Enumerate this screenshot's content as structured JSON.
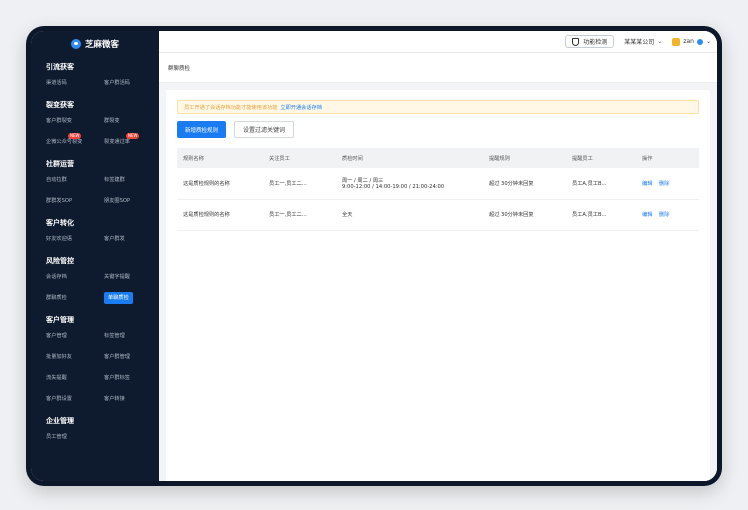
{
  "app": {
    "name": "芝麻微客"
  },
  "sidebar": {
    "groups": [
      {
        "title": "引流获客",
        "items": [
          {
            "label": "渠道活码"
          },
          {
            "label": "客户群活码"
          }
        ]
      },
      {
        "title": "裂变获客",
        "items": [
          {
            "label": "客户群裂变"
          },
          {
            "label": "群裂变"
          },
          {
            "label": "企微公众号裂变",
            "badge": "NEW"
          },
          {
            "label": "裂变通过率",
            "badge": "NEW"
          }
        ]
      },
      {
        "title": "社群运营",
        "items": [
          {
            "label": "自动拉群"
          },
          {
            "label": "标签建群"
          },
          {
            "label": "群群发SOP"
          },
          {
            "label": "朋友圈SOP"
          }
        ]
      },
      {
        "title": "客户转化",
        "items": [
          {
            "label": "好友欢迎语"
          },
          {
            "label": "客户群发"
          }
        ]
      },
      {
        "title": "风险管控",
        "items": [
          {
            "label": "会话存档"
          },
          {
            "label": "关键字提醒"
          },
          {
            "label": "群聊质检"
          },
          {
            "label": "单聊质检",
            "active": true
          }
        ]
      },
      {
        "title": "客户管理",
        "items": [
          {
            "label": "客户管理"
          },
          {
            "label": "标签管理"
          },
          {
            "label": "批量加好友"
          },
          {
            "label": "客户群管理"
          },
          {
            "label": "流失提醒"
          },
          {
            "label": "客户群标签"
          },
          {
            "label": "客户群设置"
          },
          {
            "label": "客户转接"
          }
        ]
      },
      {
        "title": "企业管理",
        "items": [
          {
            "label": "员工管理"
          }
        ]
      }
    ]
  },
  "topbar": {
    "func_check": "功能检测",
    "company": "某某某公司",
    "user": "zan"
  },
  "breadcrumb": "群聊质检",
  "notice": {
    "text": "员工开通了会话存档功能才能使用该功能",
    "link": "立即开通会话存档"
  },
  "buttons": {
    "new_rule": "新增质检规则",
    "filter_keywords": "设置过滤关键词"
  },
  "table": {
    "headers": [
      "规则名称",
      "关注员工",
      "质检时间",
      "提醒规则",
      "提醒员工",
      "操作"
    ],
    "rows": [
      {
        "name": "这是质检规则的名称",
        "staff": "员工一,员工二...",
        "time_line1": "周一 / 周二 / 周三",
        "time_line2": "9:00-12:00 / 14:00-19:00 / 21:00-24:00",
        "rule": "超过 30分钟未回复",
        "notify": "员工A,员工B...",
        "edit": "编辑",
        "delete": "删除"
      },
      {
        "name": "这是质检规则的名称",
        "staff": "员工一,员工二...",
        "time_line1": "全天",
        "time_line2": "",
        "rule": "超过 30分钟未回复",
        "notify": "员工A,员工B...",
        "edit": "编辑",
        "delete": "删除"
      }
    ]
  },
  "colors": {
    "accent": "#1b7cf2",
    "sidebar_bg": "#0e1a2e",
    "warning": "#e6a23c"
  }
}
